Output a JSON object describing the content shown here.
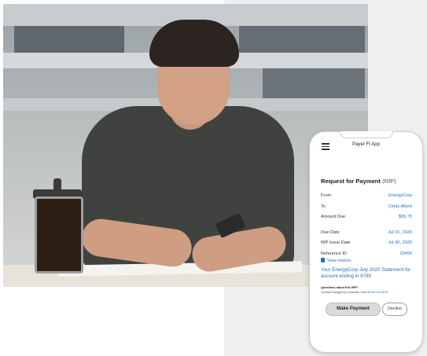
{
  "app": {
    "title": "Payer FI App"
  },
  "request": {
    "title": "Request for Payment",
    "subtitle": "(RfP)"
  },
  "details": [
    {
      "label": "From",
      "value": "EnergyCorp"
    },
    {
      "label": "To",
      "value": "Cindy Albert"
    },
    {
      "label": "Amount Due",
      "value": "$95.75"
    },
    {
      "label": "Due Date",
      "value": "Jul 31, 2020"
    },
    {
      "label": "RfP Issue Date",
      "value": "Jul 30, 2020"
    },
    {
      "label": "Reference ID",
      "value": "23456"
    }
  ],
  "invoice": {
    "link": "View Invoice"
  },
  "statement": "Your EnergyCorp July 2020 Statement for account ending in 6789",
  "questions": {
    "title": "Questions about this RfP?",
    "text": "Contact EnergyCorp Customer Care at",
    "phone": "800-234-5678"
  },
  "actions": {
    "pay": "Make Payment",
    "decline": "Decline"
  },
  "colors": {
    "link": "#1f6fbf",
    "button_bg": "#d9dadc",
    "background_panel": "#eef0f2"
  }
}
